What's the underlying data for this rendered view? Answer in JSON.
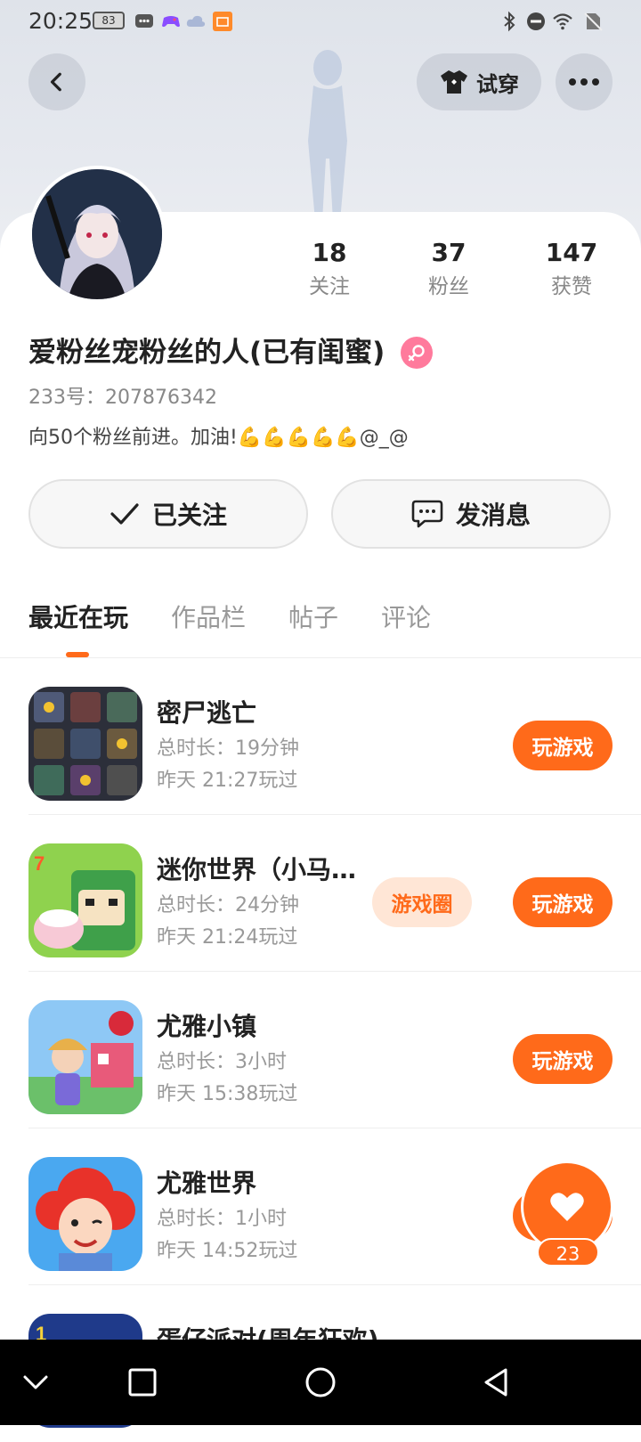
{
  "status_bar": {
    "time": "20:25",
    "battery": "83"
  },
  "header": {
    "tryon_label": "试穿"
  },
  "profile": {
    "stats": [
      {
        "value": "18",
        "label": "关注"
      },
      {
        "value": "37",
        "label": "粉丝"
      },
      {
        "value": "147",
        "label": "获赞"
      }
    ],
    "username": "爱粉丝宠粉丝的人(已有闺蜜)",
    "uid": "233号：207876342",
    "bio": "向50个粉丝前进。加油!💪💪💪💪💪@_@",
    "follow_button": "已关注",
    "message_button": "发消息"
  },
  "tabs": [
    "最近在玩",
    "作品栏",
    "帖子",
    "评论"
  ],
  "games": [
    {
      "name": "密尸逃亡",
      "duration": "总时长：19分钟",
      "last_played": "昨天 21:27玩过",
      "play": "玩游戏"
    },
    {
      "name": "迷你世界（小马宝…",
      "duration": "总时长：24分钟",
      "last_played": "昨天 21:24玩过",
      "play": "玩游戏",
      "circle": "游戏圈"
    },
    {
      "name": "尤雅小镇",
      "duration": "总时长：3小时",
      "last_played": "昨天 15:38玩过",
      "play": "玩游戏"
    },
    {
      "name": "尤雅世界",
      "duration": "总时长：1小时",
      "last_played": "昨天 14:52玩过",
      "play": ""
    },
    {
      "name": "蛋仔派对(周年狂欢)",
      "duration": "",
      "last_played": "",
      "play": ""
    }
  ],
  "like_fab": {
    "count": "23"
  },
  "colors": {
    "accent": "#ff6a1a",
    "gender": "#ff7a9c"
  }
}
